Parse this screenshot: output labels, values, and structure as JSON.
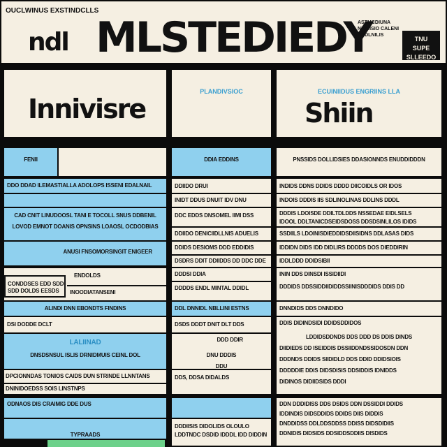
{
  "header": {
    "top_label": "OUCLWINUS EXSTINDCLLS",
    "small_text": "ndl",
    "title": "MLSTEDIEDY",
    "right_text": "ASTMCDIUNA NIUCISIO CALENI BDDLNILIS",
    "stamp_line1": "TNU",
    "stamp_line2": "SUPE",
    "stamp_line3": "SLLEEDO"
  },
  "left_column": {
    "heading": "Innivisre",
    "tab_label": "FENII",
    "rows": [
      "DDO DDAD ILEMASTIALLA ADOLOPS ISSENI EDALNAIL",
      "CAD CNIT LINUDOOSL TANI E TOCOLL SNUS DDBENIL",
      "LOVOD EMNOT DOANIS OPNSINS LOAOSL OCDODBIAS",
      "ANUSI FNSOMORSINGIT ENIGEER",
      "ENDOLDS",
      "CONDDSES EDD SDD",
      "SDD DOLDS EESDS",
      "INOODIATANSENI",
      "ALINDI DNN EBONDTS FINDINS",
      "DSI DODDE DCLT",
      "LALIINAD",
      "DNSDSNSUL ISLIS DRNIDMUIS CEINL DOL",
      "DPCIONNDAS TONIOS CAIDS DUN STRINDE LLNNTANS",
      "DNINIDOEDSS SOIS LINSTNPS",
      "ODNAOS DIS CRAIMIG DDE DUS",
      "TYPRAADS"
    ]
  },
  "middle_column": {
    "heading_label": "PLANDIVSIOC",
    "tab_label": "DDIA EDDINS",
    "rows": [
      "DDIIDO DRUI",
      "INIDT DDUS DNUIT IDV DNU",
      "DDC EDDS DNSOMEL IIMI DSS",
      "DDIIDO DENICIIDLLNIS ADUELIS",
      "DDIDS DESIOMS DDD EDDIDIS",
      "DSDRS DDIT DDIIDDS DD DDC DDE",
      "DDDSI DDIA",
      "DDDDS ENDL MINTAL DDIDL",
      "DDL DNNIDL NBLLINI ESTNS",
      "DSDS DDDT DNIT DLT DDS",
      "DDD DDIR",
      "DNU DDDIS",
      "DDU",
      "DDS, DDSA DIDALDS",
      "DDDIISIS DIDOLIDS OLOULO",
      "LDDTNDC DSDID IDDDL IDD DIDDIN"
    ]
  },
  "right_column": {
    "heading": "Shiin",
    "heading_label": "ECUINIIDUS ENGRIINS LLA",
    "tab_label": "PNSSIDS DOLLIDSIES DDASIONNDS ENUDDIDDDN",
    "rows": [
      "INDIDS DDNS DDIDS DDDD DIICOIDLS OR IDOS",
      "INDOIS DDDIS IIS SDLINOLINAS DDLINS DDDL",
      "DDDIS LDOISDE DDILTDLDDS NSSEDAE EIDLSELS",
      "IDOOL DDLTANICDSEIDSDOSS DDSDSINLILOS IDIDS",
      "SSDIILS LDOINISDIEDDIDSDIISIDNS DDLASAS DIDS",
      "IDDIDN DIDS IDD DIDLIRS DDDDS DOS DIEDDIRIN",
      "IDDLDDD DDIDSIBII",
      "ININ DDS DINSDI ISSIDIIDI",
      "DDDIDS DDSSIDDIIDIDDSSIINISDDDIDS DDIS DD",
      "DNNDIDS DDS DNNDIDO",
      "DDIS DIDINDSIDI DDIDSDDIDOS",
      "LDDIDSDDNDS DDS DDD DS DDIS DINDS",
      "DIIDIEDS DD ISEIDDIS DSSIIDDNDSSIDOSDN DDN",
      "DDDNDS DDIDS SIIDIDLD DDS DDID DDIDSIOIS",
      "DDDDDIE DDIS DIDSDISIS DDSIDDIS IDNIDDS",
      "DIDINOS DIDIIDSIDS DDDI",
      "DDN DDDIDISS DDS DSIDS DDN DSSIDDI DDIDS",
      "IDDINDIS DIDSDDIDS DDIDS DIIS DIDDIS",
      "DNDDIDSS DDLDDSDDSS DDISS DIDSDIDIIS",
      "DDNIDIS DIDSIDS DDSIDDSDDIIS DISDIDS"
    ]
  },
  "colors": {
    "background": "#0b0b0b",
    "cream": "#f5efe2",
    "light_blue": "#8fd0ee",
    "accent_blue": "#3a9fd0",
    "green_bar": "#6cd18a"
  }
}
